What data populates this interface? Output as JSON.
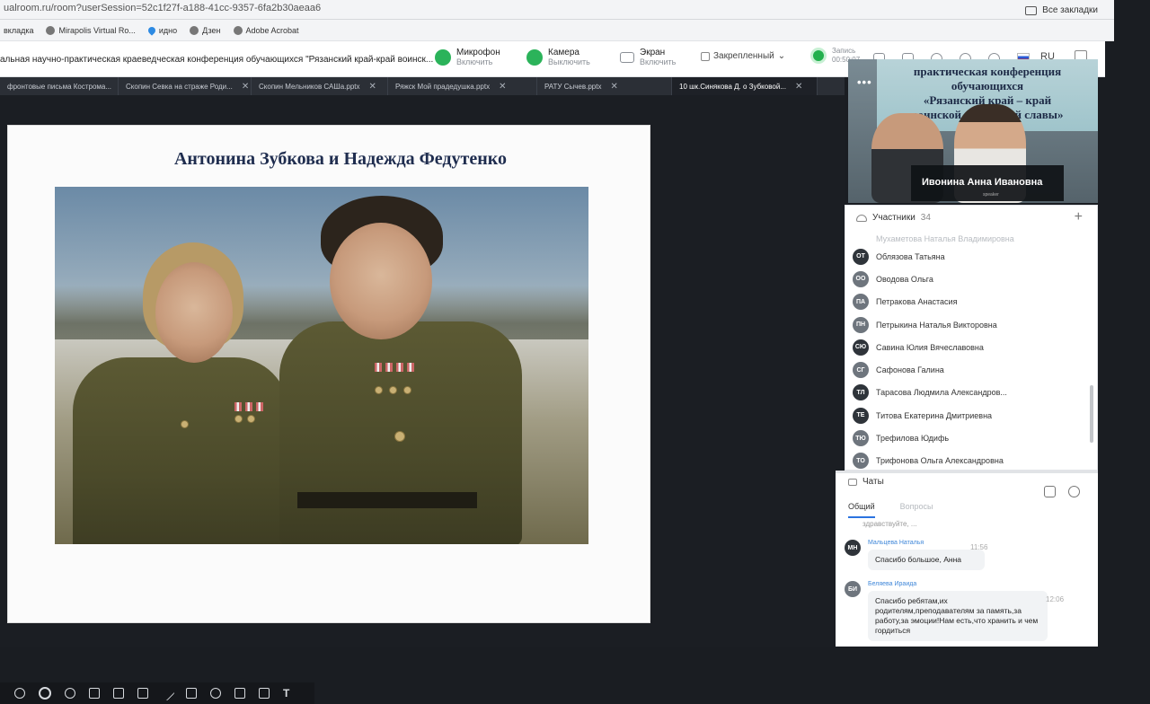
{
  "browser": {
    "url": "ualroom.ru/room?userSession=52c1f27f-a188-41cc-9357-6fa2b30aeaa6",
    "all_bookmarks": "Все закладки",
    "bookmarks": [
      {
        "label": "вкладка"
      },
      {
        "label": "Mirapolis Virtual Ro..."
      },
      {
        "label": "идно"
      },
      {
        "label": "Дзен"
      },
      {
        "label": "Adobe Acrobat"
      }
    ]
  },
  "conference": {
    "title": "альная научно-практическая краеведческая конференция обучающихся \"Рязанский край-край воинск...",
    "mic": {
      "label": "Микрофон",
      "sub": "Включить"
    },
    "camera": {
      "label": "Камера",
      "sub": "Выключить"
    },
    "screen": {
      "label": "Экран",
      "sub": "Включить"
    },
    "pinned": "Закрепленный",
    "record": {
      "label": "Запись",
      "time": "00:50:07"
    },
    "lang": "RU"
  },
  "tabs": [
    {
      "label": "фронтовые письма Кострома..."
    },
    {
      "label": "Скопин Севка на страже Роди..."
    },
    {
      "label": "Скопин Мельников САШа.pptx"
    },
    {
      "label": "Ряжск Мой прадедушка.pptx"
    },
    {
      "label": "РАТУ Сычев.pptx"
    },
    {
      "label": "10 шк.Синякова Д. о Зубковой..."
    }
  ],
  "slide": {
    "title": "Антонина Зубкова и Надежда Федутенко"
  },
  "video": {
    "banner_lines": [
      "практическая конференция",
      "обучающихся",
      "«Рязанский край – край",
      "воинской и трудовой славы»"
    ],
    "speaker": "Ивонина Анна Ивановна",
    "speaker_sub": "speaker",
    "menu": "•••"
  },
  "participants": {
    "label": "Участники",
    "count": "34",
    "list": [
      {
        "initials": "",
        "name": "Мухаметова Наталья Владимировна",
        "faded": true
      },
      {
        "initials": "ОТ",
        "name": "Облязова Татьяна"
      },
      {
        "initials": "ОО",
        "name": "Оводова Ольга"
      },
      {
        "initials": "ПА",
        "name": "Петракова Анастасия"
      },
      {
        "initials": "ПН",
        "name": "Петрыкина Наталья Викторовна"
      },
      {
        "initials": "СЮ",
        "name": "Савина Юлия Вячеславовна"
      },
      {
        "initials": "СГ",
        "name": "Сафонова Галина"
      },
      {
        "initials": "ТЛ",
        "name": "Тарасова Людмила Александров..."
      },
      {
        "initials": "ТЕ",
        "name": "Титова Екатерина Дмитриевна"
      },
      {
        "initials": "ТЮ",
        "name": "Трефилова Юдифь"
      },
      {
        "initials": "ТО",
        "name": "Трифонова Ольга Александровна"
      }
    ]
  },
  "chat": {
    "label": "Чаты",
    "tabs": {
      "general": "Общий",
      "questions": "Вопросы"
    },
    "cut_text": "здравствуйте, ...",
    "messages": [
      {
        "initials": "МН",
        "author": "Мальцева Наталья",
        "time": "11:56",
        "text": "Спасибо большое, Анна"
      },
      {
        "initials": "БИ",
        "author": "Беляева Ираида",
        "time": "12:06",
        "text": "Спасибо ребятам,их родителям,преподавателям за память,за работу,за эмоции!Нам есть,что хранить и чем гордиться"
      }
    ]
  }
}
